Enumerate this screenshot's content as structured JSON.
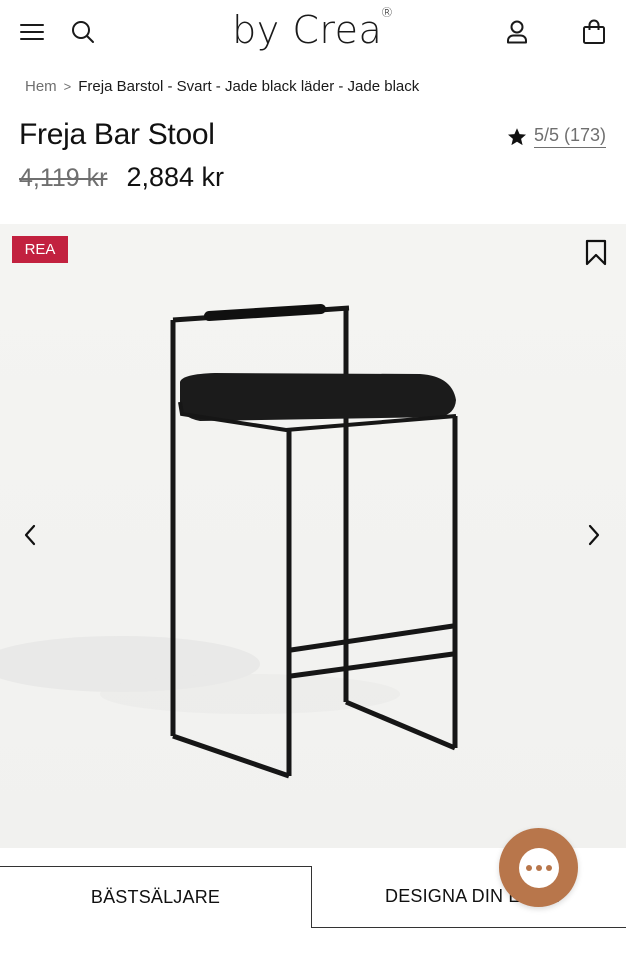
{
  "header": {
    "logo_text": "by Crea",
    "logo_mark": "®",
    "icons": [
      "menu-icon",
      "search-icon",
      "account-icon",
      "shopping-bag-icon"
    ]
  },
  "breadcrumb": {
    "home": "Hem",
    "separator": ">",
    "current": "Freja Barstol - Svart - Jade black läder - Jade black"
  },
  "product": {
    "title": "Freja Bar Stool",
    "rating": "5/5 (173)",
    "old_price": "4,119 kr",
    "price": "2,884 kr"
  },
  "gallery": {
    "sale_badge": "REA",
    "sale_badge_color": "#c2213f",
    "icons": [
      "bookmark-icon",
      "chevron-left-icon",
      "chevron-right-icon"
    ]
  },
  "tabs": [
    {
      "label": "BÄSTSÄLJARE",
      "active": true
    },
    {
      "label": "DESIGNA DIN EGEN",
      "active": false
    }
  ],
  "chat": {
    "color": "#b8764b"
  }
}
